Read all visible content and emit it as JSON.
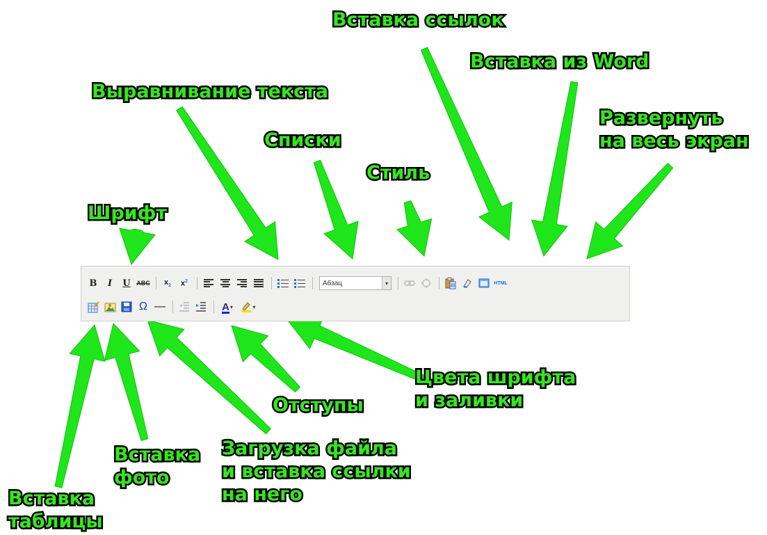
{
  "annotations": {
    "links": "Вставка ссылок",
    "word": "Вставка из Word",
    "align": "Выравнивание текста",
    "fullscreen": [
      "Развернуть",
      "на весь экран"
    ],
    "lists": "Списки",
    "style": "Стиль",
    "font": "Шрифт",
    "colors": [
      "Цвета шрифта",
      "и заливки"
    ],
    "indents": "Отступы",
    "upload": [
      "Загрузка файла",
      "и вставка ссылки",
      "на него"
    ],
    "photo": [
      "Вставка",
      "фото"
    ],
    "table": [
      "Вставка",
      "таблицы"
    ]
  },
  "toolbar": {
    "bold": "B",
    "italic": "I",
    "underline": "U",
    "strike": "ABC",
    "subscript": "x",
    "subscript_mark": "2",
    "superscript": "x",
    "superscript_mark": "2",
    "style_select_value": "Абзац",
    "html": "HTML",
    "special_char": "Ω",
    "hr": "—",
    "font_color": "A"
  },
  "colors": {
    "label_fill": "#35e61f",
    "label_outline": "#000000",
    "arrow_fill": "#1fe61a",
    "toolbar_bg": "#f0f0ee"
  },
  "icons": [
    "bold-icon",
    "italic-icon",
    "underline-icon",
    "strikethrough-icon",
    "subscript-icon",
    "superscript-icon",
    "align-left-icon",
    "align-center-icon",
    "align-right-icon",
    "align-justify-icon",
    "bullet-list-icon",
    "numbered-list-icon",
    "link-icon",
    "unlink-icon",
    "paste-word-icon",
    "cleanup-icon",
    "fullscreen-icon",
    "html-icon",
    "table-icon",
    "image-icon",
    "save-file-icon",
    "omega-icon",
    "hr-icon",
    "outdent-icon",
    "indent-icon",
    "font-color-icon",
    "highlight-icon"
  ]
}
